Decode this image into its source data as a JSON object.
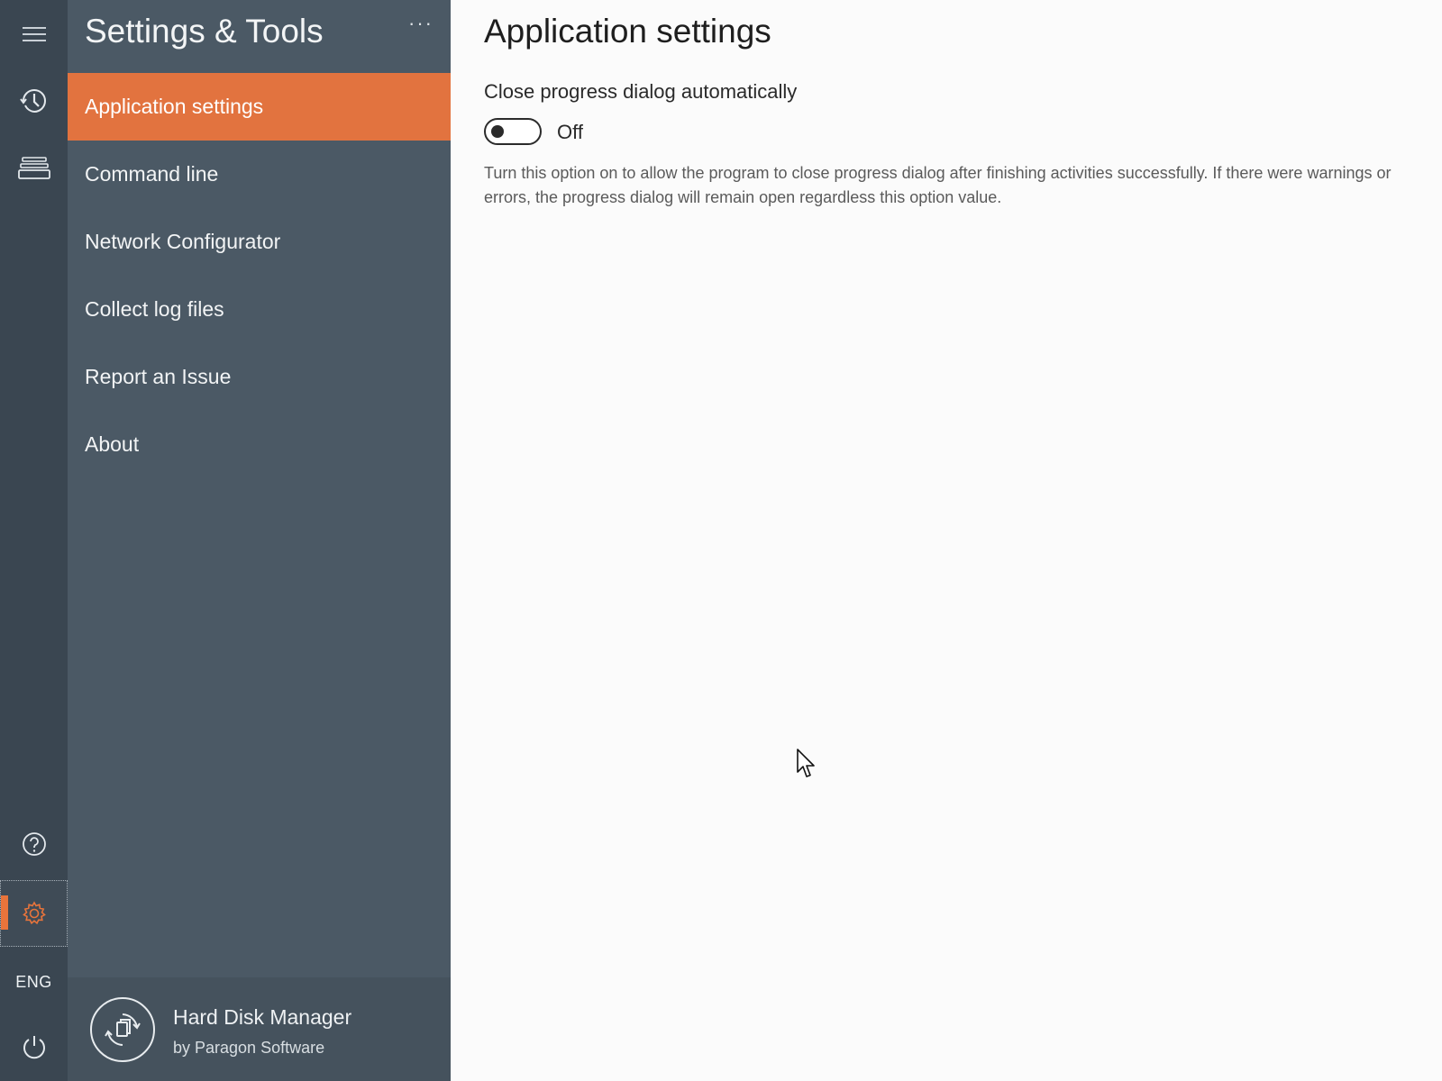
{
  "rail": {
    "menu_icon": "hamburger-icon",
    "history_icon": "clock-history-icon",
    "disks_icon": "disk-stack-icon",
    "help_icon": "help-circle-icon",
    "settings_icon": "gear-icon",
    "language": "ENG",
    "power_icon": "power-icon",
    "accent_color": "#e8743b"
  },
  "panel": {
    "title": "Settings & Tools",
    "more_icon": "ellipsis-icon",
    "more_label": "···",
    "items": [
      {
        "label": "Application settings",
        "selected": true
      },
      {
        "label": "Command line",
        "selected": false
      },
      {
        "label": "Network Configurator",
        "selected": false
      },
      {
        "label": "Collect log files",
        "selected": false
      },
      {
        "label": "Report an Issue",
        "selected": false
      },
      {
        "label": "About",
        "selected": false
      }
    ],
    "brand": {
      "logo_icon": "paragon-logo-icon",
      "name": "Hard Disk Manager",
      "subtitle": "by Paragon Software"
    }
  },
  "content": {
    "title": "Application settings",
    "setting": {
      "label": "Close progress dialog automatically",
      "toggle_on": false,
      "state_text": "Off",
      "description": "Turn this option on to allow the program to close progress dialog after finishing activities successfully. If there were warnings or errors, the progress dialog will remain open regardless this option value."
    }
  },
  "colors": {
    "rail_bg": "#3a4651",
    "panel_bg": "#4b5965",
    "selected_item": "#e2733f",
    "content_bg": "#fbfbfb"
  }
}
